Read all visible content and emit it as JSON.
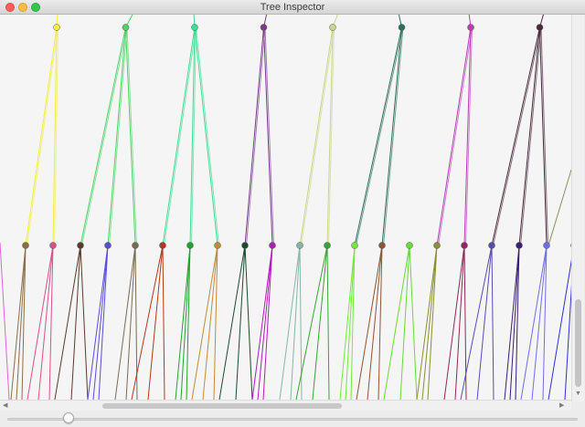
{
  "window": {
    "title": "Tree Inspector"
  },
  "tree": {
    "top_nodes": [
      {
        "label": "",
        "color": "#f2ee3c",
        "children": [
          1,
          0
        ]
      },
      {
        "label": "",
        "color": "#4fd26a",
        "children": [
          2,
          3,
          4
        ]
      },
      {
        "label": "",
        "color": "#3fdc93",
        "children": [
          5,
          6,
          7
        ]
      },
      {
        "label": "",
        "color": "#7a3a8e",
        "children": [
          9,
          8
        ]
      },
      {
        "label": "",
        "color": "#c8d68c",
        "children": [
          11,
          10
        ]
      },
      {
        "label": "",
        "color": "#2f6e5c",
        "children": [
          12,
          13
        ]
      },
      {
        "label": "",
        "color": "#b341b3",
        "children": [
          16,
          15
        ]
      },
      {
        "label": "",
        "color": "#4a2a3c",
        "children": [
          17,
          18,
          19
        ]
      }
    ],
    "bottom_nodes": [
      {
        "label": "",
        "color": "#8a6e4a"
      },
      {
        "label": "",
        "color": "#d94f8c"
      },
      {
        "label": "",
        "color": "#5a3a2c"
      },
      {
        "label": "",
        "color": "#5b4cd6"
      },
      {
        "label": "",
        "color": "#7a6a54"
      },
      {
        "label": "",
        "color": "#b3361f"
      },
      {
        "label": "",
        "color": "#21a32c"
      },
      {
        "label": "",
        "color": "#c38a3c"
      },
      {
        "label": "",
        "color": "#1d4a2c"
      },
      {
        "label": "",
        "color": "#b01db6"
      },
      {
        "label": "",
        "color": "#86b5a8"
      },
      {
        "label": "",
        "color": "#3aa23a"
      },
      {
        "label": "",
        "color": "#74e83c"
      },
      {
        "label": "",
        "color": "#8e5436"
      },
      {
        "label": "",
        "color": "#68d83a"
      },
      {
        "label": "",
        "color": "#8a8e36"
      },
      {
        "label": "",
        "color": "#8c2a5c"
      },
      {
        "label": "",
        "color": "#5a4ab0"
      },
      {
        "label": "",
        "color": "#3a1d74"
      },
      {
        "label": "",
        "color": "#6e6ee6"
      },
      {
        "label": "",
        "color": "#2e2ed8"
      }
    ]
  },
  "slider": {
    "value": 0.1
  }
}
